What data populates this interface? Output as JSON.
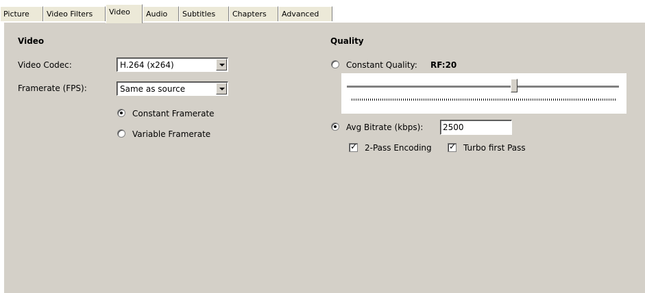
{
  "tabs": [
    {
      "label": "Picture"
    },
    {
      "label": "Video Filters"
    },
    {
      "label": "Video",
      "active": true
    },
    {
      "label": "Audio"
    },
    {
      "label": "Subtitles"
    },
    {
      "label": "Chapters"
    },
    {
      "label": "Advanced"
    }
  ],
  "video": {
    "heading": "Video",
    "codec_label": "Video Codec:",
    "codec_value": "H.264 (x264)",
    "framerate_label": "Framerate (FPS):",
    "framerate_value": "Same as source",
    "constant_framerate": "Constant Framerate",
    "variable_framerate": "Variable Framerate",
    "constant_selected": true
  },
  "quality": {
    "heading": "Quality",
    "constant_quality_label": "Constant Quality:",
    "rf_value": "RF:20",
    "slider_fraction": 0.615,
    "avg_bitrate_label": "Avg Bitrate (kbps):",
    "avg_bitrate_value": "2500",
    "avg_bitrate_selected": true,
    "two_pass_label": "2-Pass Encoding",
    "two_pass_checked": true,
    "turbo_label": "Turbo first Pass",
    "turbo_checked": true
  }
}
